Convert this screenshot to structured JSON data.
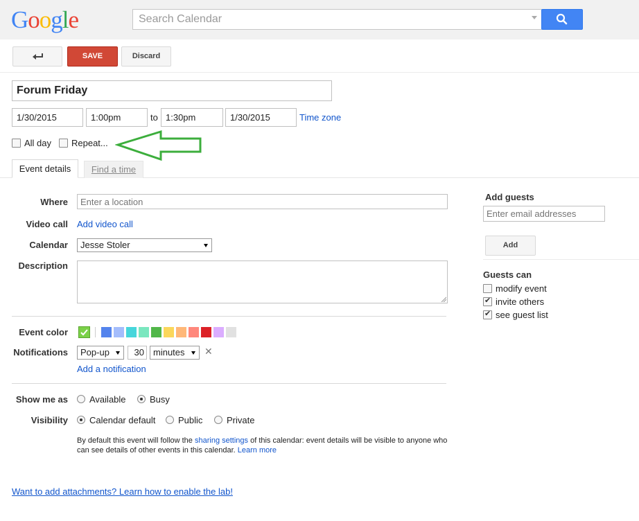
{
  "header": {
    "logo": "Google",
    "search_placeholder": "Search Calendar"
  },
  "toolbar": {
    "save_label": "SAVE",
    "discard_label": "Discard"
  },
  "event": {
    "title": "Forum Friday",
    "start_date": "1/30/2015",
    "start_time": "1:00pm",
    "to_label": "to",
    "end_time": "1:30pm",
    "end_date": "1/30/2015",
    "timezone_link": "Time zone",
    "all_day_label": "All day",
    "repeat_label": "Repeat..."
  },
  "tabs": {
    "event_details": "Event details",
    "find_a_time": "Find a time"
  },
  "details": {
    "where_label": "Where",
    "where_placeholder": "Enter a location",
    "video_label": "Video call",
    "video_link": "Add video call",
    "calendar_label": "Calendar",
    "calendar_value": "Jesse Stoler",
    "description_label": "Description",
    "event_color_label": "Event color",
    "notifications_label": "Notifications",
    "notification_type": "Pop-up",
    "notification_amount": "30",
    "notification_unit": "minutes",
    "add_notification_link": "Add a notification",
    "show_me_as_label": "Show me as",
    "available_label": "Available",
    "busy_label": "Busy",
    "visibility_label": "Visibility",
    "calendar_default_label": "Calendar default",
    "public_label": "Public",
    "private_label": "Private",
    "visibility_note_1": "By default this event will follow the ",
    "sharing_settings_link": "sharing settings",
    "visibility_note_2": " of this calendar: event details will be visible to anyone who",
    "visibility_note_3": "can see details of other events in this calendar.  ",
    "learn_more_link": "Learn more"
  },
  "colors": [
    "#5484ed",
    "#a4bdfc",
    "#46d6db",
    "#7ae7bf",
    "#51b749",
    "#fbd75b",
    "#ffb878",
    "#ff887c",
    "#dc2127",
    "#dbadff",
    "#e1e1e1"
  ],
  "selected_color": "#7bd148",
  "guests": {
    "add_guests_label": "Add guests",
    "email_placeholder": "Enter email addresses",
    "add_button": "Add",
    "guests_can_label": "Guests can",
    "modify_event": "modify event",
    "invite_others": "invite others",
    "see_guest_list": "see guest list"
  },
  "footer": {
    "attachments_link": "Want to add attachments? Learn how to enable the lab!"
  },
  "annotation": {
    "arrow_color": "#3cae3c"
  }
}
